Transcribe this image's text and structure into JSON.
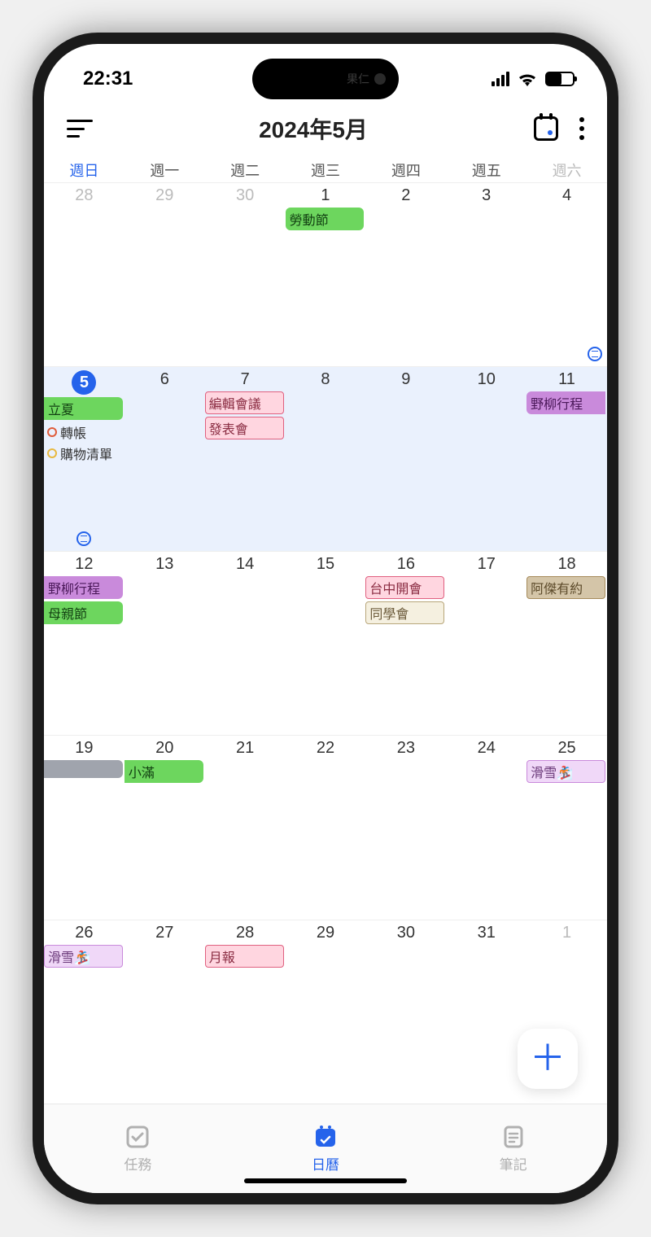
{
  "statusbar": {
    "time": "22:31"
  },
  "header": {
    "title": "2024年5月"
  },
  "weekdays": [
    "週日",
    "週一",
    "週二",
    "週三",
    "週四",
    "週五",
    "週六"
  ],
  "weeks": [
    {
      "days": [
        {
          "num": "28",
          "other": true
        },
        {
          "num": "29",
          "other": true
        },
        {
          "num": "30",
          "other": true
        },
        {
          "num": "1",
          "events": [
            {
              "text": "勞動節",
              "cls": "ev-green-full"
            }
          ]
        },
        {
          "num": "2"
        },
        {
          "num": "3"
        },
        {
          "num": "4"
        }
      ],
      "note_right": true
    },
    {
      "current": true,
      "days": [
        {
          "num": "5",
          "today": true,
          "events": [
            {
              "text": "立夏",
              "cls": "ev-green"
            }
          ],
          "bullets": [
            {
              "text": "轉帳",
              "color": "red"
            },
            {
              "text": "購物清單",
              "color": "yellow"
            }
          ],
          "note_bottom": true
        },
        {
          "num": "6"
        },
        {
          "num": "7",
          "events": [
            {
              "text": "編輯會議",
              "cls": "ev-pink"
            },
            {
              "text": "發表會",
              "cls": "ev-pink"
            }
          ]
        },
        {
          "num": "8"
        },
        {
          "num": "9"
        },
        {
          "num": "10"
        },
        {
          "num": "11",
          "events": [
            {
              "text": "野柳行程",
              "cls": "ev-purple-l"
            }
          ]
        }
      ]
    },
    {
      "days": [
        {
          "num": "12",
          "events": [
            {
              "text": "野柳行程",
              "cls": "ev-purple-r"
            },
            {
              "text": "母親節",
              "cls": "ev-green"
            }
          ]
        },
        {
          "num": "13"
        },
        {
          "num": "14"
        },
        {
          "num": "15"
        },
        {
          "num": "16",
          "events": [
            {
              "text": "台中開會",
              "cls": "ev-pink"
            },
            {
              "text": "同學會",
              "cls": "ev-beige"
            }
          ]
        },
        {
          "num": "17"
        },
        {
          "num": "18",
          "events": [
            {
              "text": "阿傑有約",
              "cls": "ev-brown"
            }
          ]
        }
      ]
    },
    {
      "days": [
        {
          "num": "19",
          "events": [
            {
              "text": "",
              "cls": "ev-gray"
            }
          ]
        },
        {
          "num": "20",
          "events": [
            {
              "text": "小滿",
              "cls": "ev-green"
            }
          ]
        },
        {
          "num": "21"
        },
        {
          "num": "22"
        },
        {
          "num": "23"
        },
        {
          "num": "24"
        },
        {
          "num": "25",
          "events": [
            {
              "text": "滑雪🏂",
              "cls": "ev-violet"
            }
          ]
        }
      ]
    },
    {
      "days": [
        {
          "num": "26",
          "events": [
            {
              "text": "滑雪🏂",
              "cls": "ev-violet"
            }
          ]
        },
        {
          "num": "27"
        },
        {
          "num": "28",
          "events": [
            {
              "text": "月報",
              "cls": "ev-pink"
            }
          ]
        },
        {
          "num": "29"
        },
        {
          "num": "30"
        },
        {
          "num": "31"
        },
        {
          "num": "1",
          "other": true
        }
      ]
    }
  ],
  "nav": {
    "tasks": "任務",
    "calendar": "日曆",
    "notes": "筆記"
  },
  "island_text": "果仁"
}
